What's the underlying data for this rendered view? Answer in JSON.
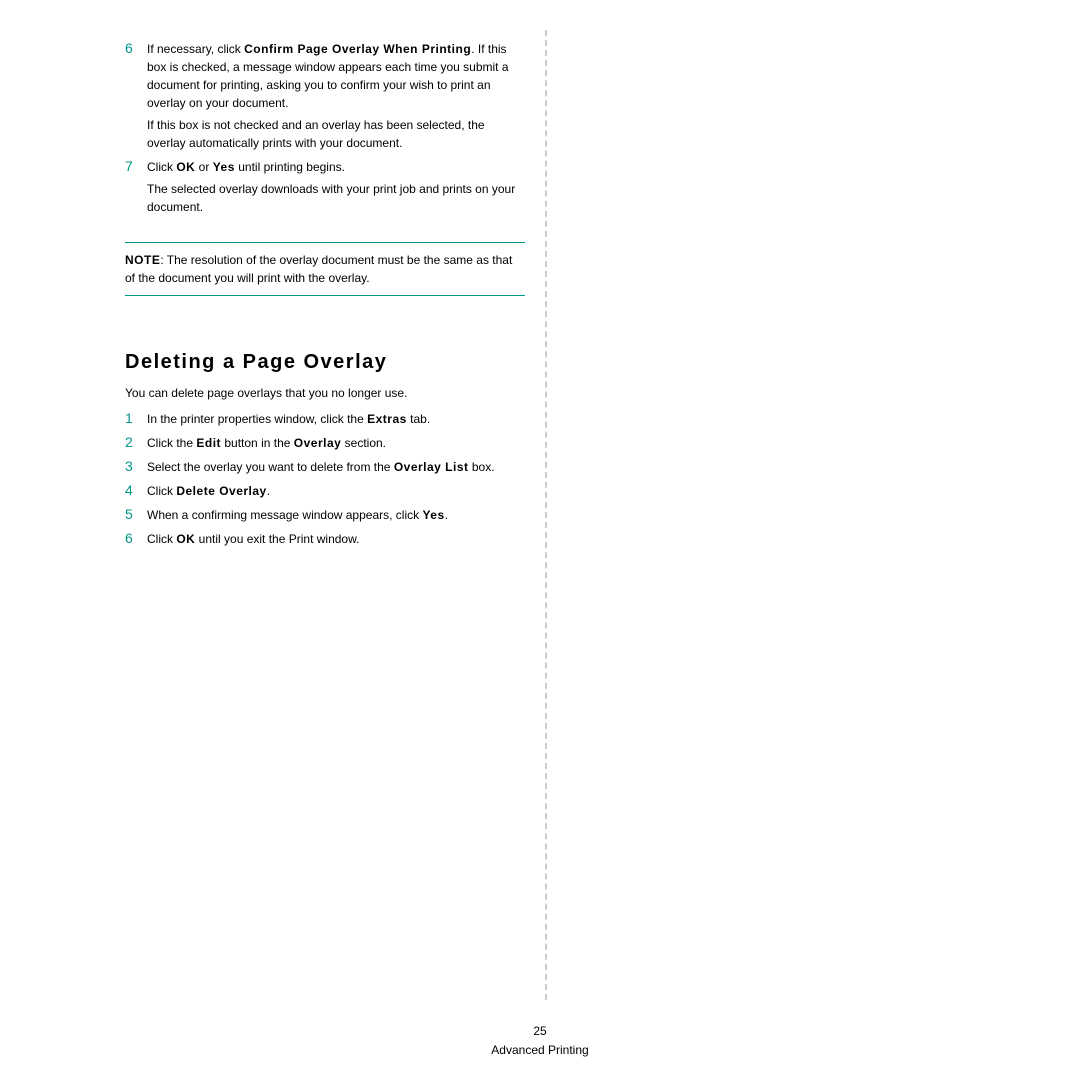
{
  "steps_top": [
    {
      "num": "6",
      "paras": [
        {
          "segments": [
            {
              "t": "If necessary, click ",
              "b": false
            },
            {
              "t": "Confirm Page Overlay When Printing",
              "b": true
            },
            {
              "t": ". If this box is checked, a message window appears each time you submit a document for printing, asking you to confirm your wish to print an overlay on your document.",
              "b": false
            }
          ]
        },
        {
          "segments": [
            {
              "t": "If this box is not checked and an overlay has been selected, the overlay automatically prints with your document.",
              "b": false
            }
          ]
        }
      ]
    },
    {
      "num": "7",
      "paras": [
        {
          "segments": [
            {
              "t": "Click ",
              "b": false
            },
            {
              "t": "OK",
              "b": true
            },
            {
              "t": " or ",
              "b": false
            },
            {
              "t": "Yes",
              "b": true
            },
            {
              "t": " until printing begins.",
              "b": false
            }
          ]
        },
        {
          "segments": [
            {
              "t": "The selected overlay downloads with your print job and prints on your document.",
              "b": false
            }
          ]
        }
      ]
    }
  ],
  "note": {
    "label": "NOTE",
    "text": ": The resolution of the overlay document must be the same as that of the document you will print with the overlay."
  },
  "section2": {
    "heading": "Deleting a Page Overlay",
    "intro": "You can delete page overlays that you no longer use.",
    "steps": [
      {
        "num": "1",
        "segments": [
          {
            "t": "In the printer properties window, click the ",
            "b": false
          },
          {
            "t": "Extras",
            "b": true
          },
          {
            "t": " tab.",
            "b": false
          }
        ]
      },
      {
        "num": "2",
        "segments": [
          {
            "t": "Click the ",
            "b": false
          },
          {
            "t": "Edit",
            "b": true
          },
          {
            "t": " button in the ",
            "b": false
          },
          {
            "t": "Overlay",
            "b": true
          },
          {
            "t": " section.",
            "b": false
          }
        ]
      },
      {
        "num": "3",
        "segments": [
          {
            "t": "Select the overlay you want to delete from the ",
            "b": false
          },
          {
            "t": "Overlay List",
            "b": true
          },
          {
            "t": " box.",
            "b": false
          }
        ]
      },
      {
        "num": "4",
        "segments": [
          {
            "t": "Click ",
            "b": false
          },
          {
            "t": "Delete Overlay",
            "b": true
          },
          {
            "t": ".",
            "b": false
          }
        ]
      },
      {
        "num": "5",
        "segments": [
          {
            "t": "When a confirming message window appears, click ",
            "b": false
          },
          {
            "t": "Yes",
            "b": true
          },
          {
            "t": ".",
            "b": false
          }
        ]
      },
      {
        "num": "6",
        "segments": [
          {
            "t": "Click ",
            "b": false
          },
          {
            "t": "OK",
            "b": true
          },
          {
            "t": " until you exit the Print window.",
            "b": false
          }
        ]
      }
    ]
  },
  "footer": {
    "page_num": "25",
    "section": "Advanced Printing"
  }
}
